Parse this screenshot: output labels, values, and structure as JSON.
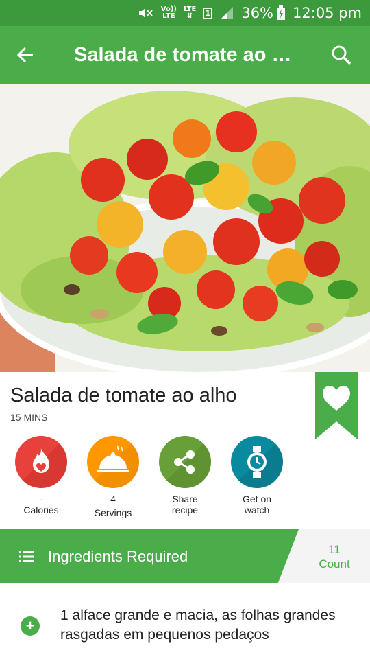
{
  "status_bar": {
    "volte_top": "Vo))",
    "volte_bottom": "LTE",
    "lte": "LTE",
    "sim": "1",
    "battery": "36%",
    "time": "12:05 pm"
  },
  "toolbar": {
    "title": "Salada de tomate ao al…",
    "back_icon": "arrow-left-icon",
    "search_icon": "search-icon"
  },
  "recipe": {
    "title": "Salada de tomate ao alho",
    "time": "15 MINS"
  },
  "stats": [
    {
      "value": "-",
      "label": "Calories",
      "color": "#e8403a",
      "icon": "flame-heart-icon"
    },
    {
      "value": "4",
      "label": "Servings",
      "color": "#ff9800",
      "icon": "serving-cloche-icon"
    },
    {
      "value": "Share",
      "label": "recipe",
      "color": "#689f38",
      "icon": "share-icon"
    },
    {
      "value": "Get on",
      "label": "watch",
      "color": "#0a8a9e",
      "icon": "watch-icon"
    }
  ],
  "ingredients": {
    "header": "Ingredients Required",
    "count_value": "11",
    "count_label": "Count",
    "items": [
      "1 alface grande e macia, as folhas grandes rasgadas em pequenos pedaços"
    ]
  },
  "colors": {
    "status_bar": "#3c9a3c",
    "toolbar": "#4aad4a",
    "accent": "#4aad4a"
  }
}
